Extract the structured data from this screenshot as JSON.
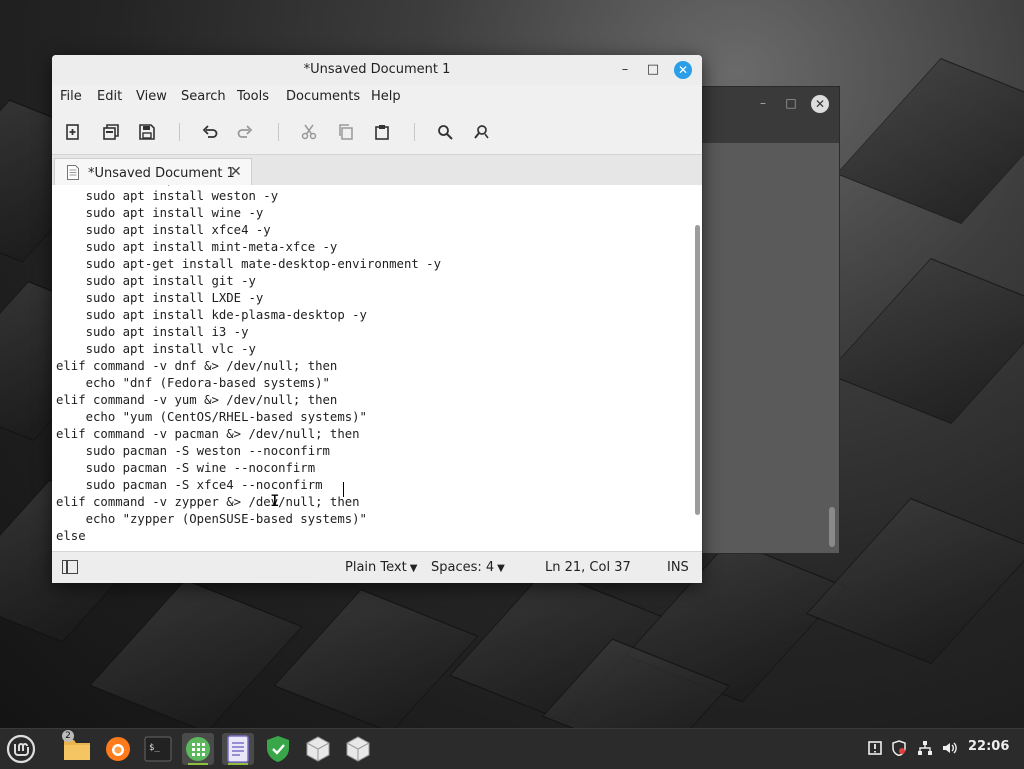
{
  "window": {
    "title": "*Unsaved Document 1",
    "minimize_glyph": "–",
    "maximize_glyph": "□",
    "close_glyph": "✕"
  },
  "menu": [
    "File",
    "Edit",
    "Search",
    "View",
    "Tools",
    "Documents",
    "Help"
  ],
  "menu_labels": {
    "file": "File",
    "edit": "Edit",
    "view": "View",
    "search": "Search",
    "tools": "Tools",
    "documents": "Documents",
    "help": "Help"
  },
  "toolbar_icons": [
    "new-document-icon",
    "open-icon",
    "save-icon",
    "undo-icon",
    "redo-icon",
    "cut-icon",
    "copy-icon",
    "paste-icon",
    "find-icon",
    "find-replace-icon"
  ],
  "tab": {
    "label": "*Unsaved Document 1",
    "close_glyph": "✕"
  },
  "editor_text": "if command -v apt &> /dev/null; then\n    sudo apt install weston -y\n    sudo apt install wine -y\n    sudo apt install xfce4 -y\n    sudo apt install mint-meta-xfce -y\n    sudo apt-get install mate-desktop-environment -y\n    sudo apt install git -y\n    sudo apt install LXDE -y\n    sudo apt install kde-plasma-desktop -y\n    sudo apt install i3 -y\n    sudo apt install vlc -y\nelif command -v dnf &> /dev/null; then\n    echo \"dnf (Fedora-based systems)\"\nelif command -v yum &> /dev/null; then\n    echo \"yum (CentOS/RHEL-based systems)\"\nelif command -v pacman &> /dev/null; then\n    sudo pacman -S weston --noconfirm\n    sudo pacman -S wine --noconfirm\n    sudo pacman -S xfce4 --noconfirm\nelif command -v zypper &> /dev/null; then\n    echo \"zypper (OpenSUSE-based systems)\"\nelse",
  "statusbar": {
    "language": "Plain Text",
    "spaces": "Spaces: 4",
    "position": "Ln 21, Col 37",
    "mode": "INS"
  },
  "taskbar": {
    "files_badge": "2",
    "clock": "22:06",
    "apps": [
      "mint-menu-icon",
      "files-icon",
      "firefox-icon",
      "terminal-icon",
      "calculator-icon",
      "text-editor-icon",
      "shield-icon",
      "package-icon",
      "package-icon"
    ]
  },
  "colors": {
    "accent": "#2a9ee8",
    "taskbar": "#2b2b2b",
    "mint_green": "#8fbf3f"
  }
}
